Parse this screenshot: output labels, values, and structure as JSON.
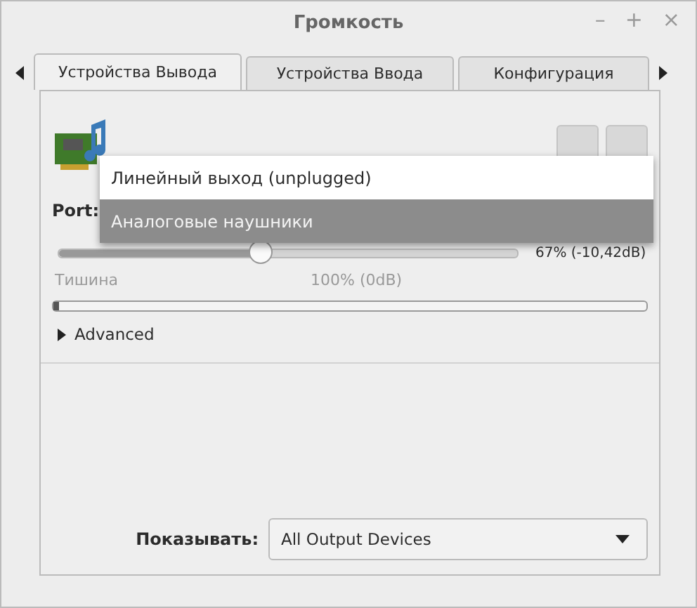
{
  "window": {
    "title": "Громкость",
    "controls": [
      "–",
      "+",
      "×"
    ]
  },
  "tabs": [
    {
      "label": "Устройства Вывода",
      "selected": true
    },
    {
      "label": "Устройства Ввода",
      "selected": false
    },
    {
      "label": "Конфигурация",
      "selected": false
    }
  ],
  "port": {
    "label": "Port:",
    "options": [
      {
        "label": "Линейный выход (unplugged)",
        "selected": false
      },
      {
        "label": "Аналоговые наушники",
        "selected": true
      }
    ]
  },
  "volume": {
    "level": 0.44,
    "reading": "67% (-10,42dB)",
    "marks": [
      "Тишина",
      "100% (0dB)"
    ]
  },
  "meter": {
    "level": 0.01
  },
  "advanced": {
    "label": "Advanced",
    "expanded": false
  },
  "show": {
    "label": "Показывать:",
    "value": "All Output Devices"
  }
}
